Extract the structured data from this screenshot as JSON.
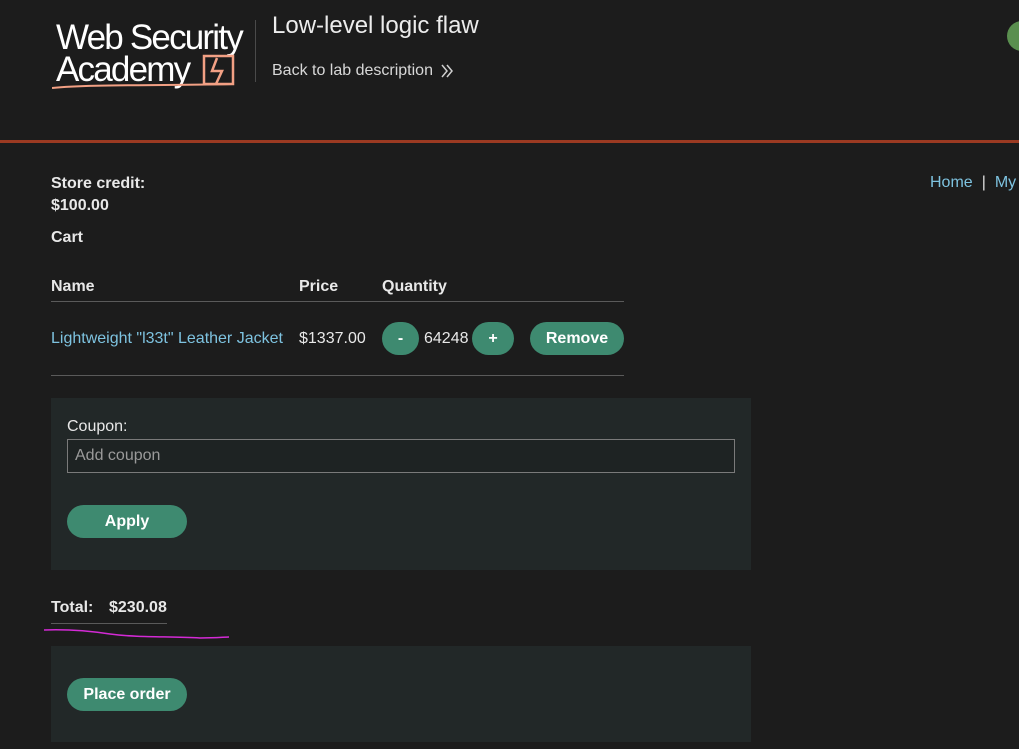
{
  "header": {
    "logo_line1": "Web Security",
    "logo_line2": "Academy",
    "lab_title": "Low-level logic flaw",
    "back_link": "Back to lab description"
  },
  "nav": {
    "home": "Home",
    "separator": "|",
    "account": "My"
  },
  "store": {
    "credit_label": "Store credit:",
    "credit_value": "$100.00"
  },
  "cart": {
    "title": "Cart",
    "columns": [
      "Name",
      "Price",
      "Quantity"
    ],
    "items": [
      {
        "name": "Lightweight \"l33t\" Leather Jacket",
        "price": "$1337.00",
        "quantity": "64248",
        "minus_label": "-",
        "plus_label": "+",
        "remove_label": "Remove"
      }
    ]
  },
  "coupon": {
    "label": "Coupon:",
    "placeholder": "Add coupon",
    "apply_label": "Apply"
  },
  "total": {
    "label": "Total:",
    "value": "$230.08"
  },
  "order": {
    "place_order_label": "Place order"
  },
  "colors": {
    "background": "#1c1c1c",
    "accent_green": "#3e8a70",
    "link_blue": "#7ec3e0",
    "header_rule": "#9b3a22",
    "panel": "#222828",
    "annotation": "#d42ad6"
  },
  "icons": [
    "logo-lightning-icon",
    "double-chevron-right-icon",
    "lab-status-icon"
  ]
}
